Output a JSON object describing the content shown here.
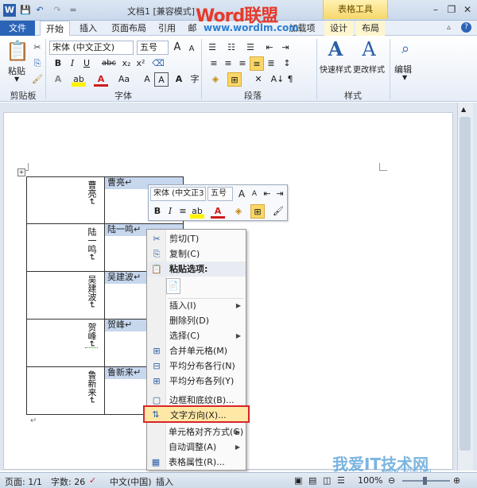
{
  "titlebar": {
    "title": "文档1 [兼容模式] -",
    "table_tools": "表格工具",
    "quick_access": [
      "W",
      "💾",
      "↶",
      "↷",
      "="
    ],
    "window_buttons": [
      "–",
      "❐",
      "✕"
    ]
  },
  "watermark": {
    "brand": "Word联盟",
    "url": "www.wordlm.com",
    "bottom_brand": "我爱IT技术网",
    "bottom_url": "www.52ij.com"
  },
  "tabs": {
    "file": "文件",
    "home": "开始",
    "insert": "插入",
    "page_layout": "页面布局",
    "references": "引用",
    "hidden": "邮",
    "addins": "加载项",
    "design": "设计",
    "layout": "布局"
  },
  "ribbon": {
    "clipboard": {
      "paste": "粘贴",
      "label": "剪贴板"
    },
    "font": {
      "font_name": "宋体 (中文正文)",
      "font_size": "五号",
      "buttons": [
        "B",
        "I",
        "U",
        "abc",
        "x₂",
        "x²"
      ],
      "label": "字体"
    },
    "paragraph": {
      "label": "段落"
    },
    "styles": {
      "quick": "快速样式",
      "change": "更改样式",
      "label": "样式"
    },
    "editing": {
      "label": "编辑"
    }
  },
  "table": {
    "rows": [
      {
        "left": "曹亮↵",
        "right": "曹亮↵"
      },
      {
        "left": "陆一鸣↵",
        "right": "陆一鸣↵"
      },
      {
        "left": "吴建波↵",
        "right": "吴建波↵"
      },
      {
        "left": "贺峰↵",
        "right": "贺峰↵"
      },
      {
        "left": "鲁新来↵",
        "right": "鲁新来↵"
      }
    ],
    "end_mark": "↵"
  },
  "mini_toolbar": {
    "font_name": "宋体 (中文正3",
    "font_size": "五号"
  },
  "context_menu": {
    "items": [
      {
        "icon": "✂",
        "label": "剪切(T)",
        "arrow": ""
      },
      {
        "icon": "⎘",
        "label": "复制(C)",
        "arrow": ""
      },
      {
        "icon": "📋",
        "label": "粘贴选项:",
        "arrow": ""
      },
      {
        "icon": "",
        "label": "",
        "arrow": ""
      },
      {
        "icon": "",
        "label": "插入(I)",
        "arrow": "▶"
      },
      {
        "icon": "",
        "label": "删除列(D)",
        "arrow": ""
      },
      {
        "icon": "",
        "label": "选择(C)",
        "arrow": "▶"
      },
      {
        "icon": "⊞",
        "label": "合并单元格(M)",
        "arrow": ""
      },
      {
        "icon": "⊟",
        "label": "平均分布各行(N)",
        "arrow": ""
      },
      {
        "icon": "⊞",
        "label": "平均分布各列(Y)",
        "arrow": ""
      },
      {
        "icon": "▢",
        "label": "边框和底纹(B)...",
        "arrow": ""
      },
      {
        "icon": "⇅",
        "label": "文字方向(X)...",
        "arrow": ""
      },
      {
        "icon": "",
        "label": "单元格对齐方式(G)",
        "arrow": "▶"
      },
      {
        "icon": "",
        "label": "自动调整(A)",
        "arrow": "▶"
      },
      {
        "icon": "▦",
        "label": "表格属性(R)...",
        "arrow": ""
      }
    ]
  },
  "statusbar": {
    "page": "页面: 1/1",
    "words": "字数: 26",
    "language": "中文(中国)",
    "mode": "插入",
    "zoom": "100%"
  }
}
